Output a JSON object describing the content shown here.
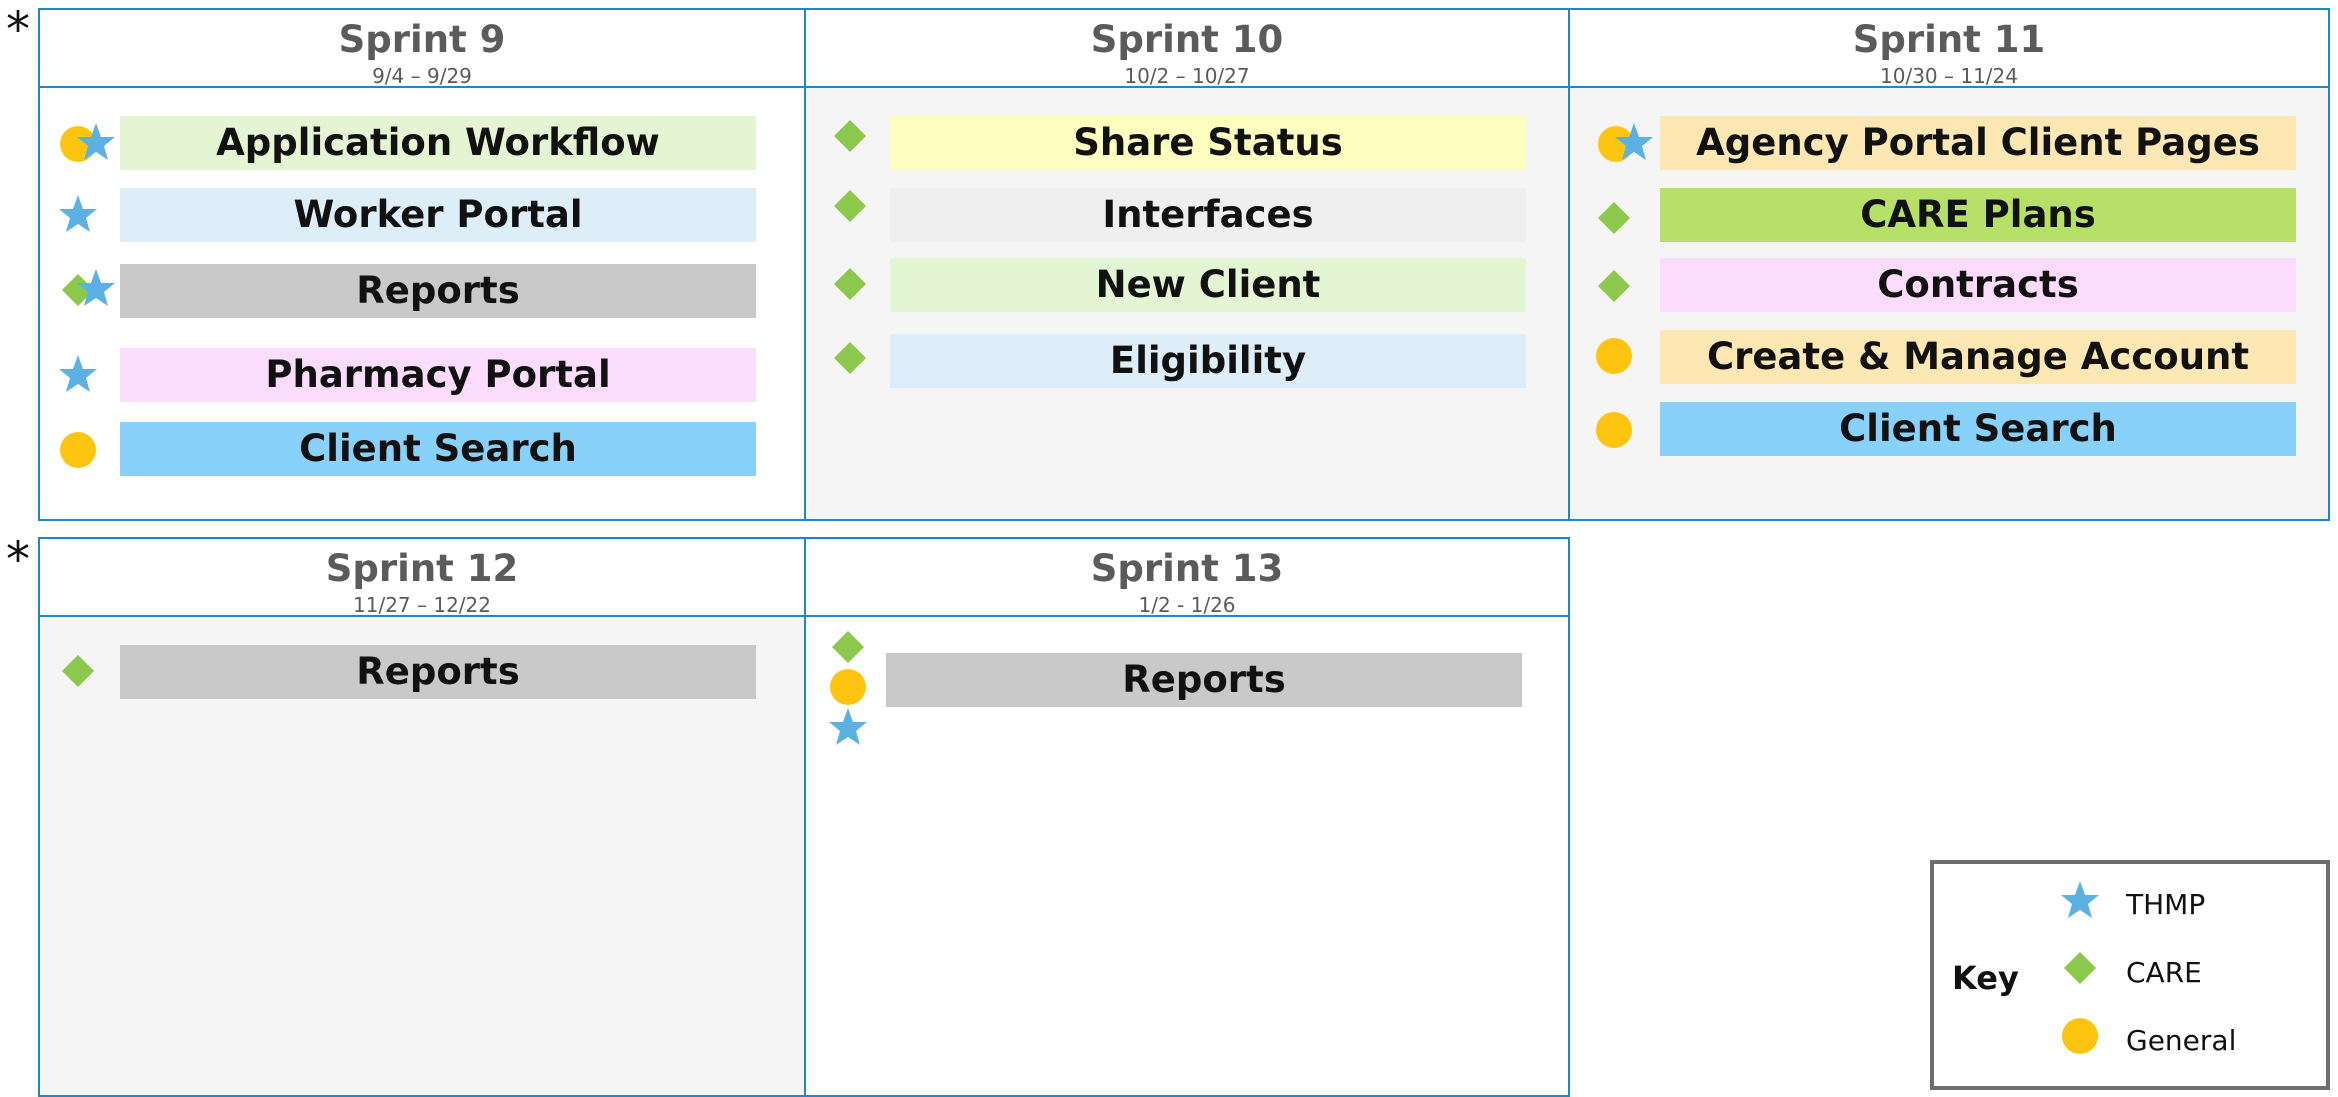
{
  "colors": {
    "border": "#1f86c8",
    "thmp": "#5bb1e4",
    "care": "#8cc84b",
    "general": "#fdc50f"
  },
  "markers": [
    "*",
    "*"
  ],
  "sprints": {
    "s9": {
      "title": "Sprint 9",
      "dates": "9/4 – 9/29",
      "items": [
        {
          "label": "Application Workflow",
          "color": "#e4f5d4",
          "icons": [
            "general",
            "thmp"
          ]
        },
        {
          "label": "Worker Portal",
          "color": "#ddeef8",
          "icons": [
            "thmp"
          ]
        },
        {
          "label": "Reports",
          "color": "#c9c9c9",
          "icons": [
            "care",
            "thmp"
          ]
        },
        {
          "label": "Pharmacy Portal",
          "color": "#fcdcfc",
          "icons": [
            "thmp"
          ]
        },
        {
          "label": "Client Search",
          "color": "#88d1fb",
          "icons": [
            "general"
          ]
        }
      ]
    },
    "s10": {
      "title": "Sprint 10",
      "dates": "10/2 – 10/27",
      "items": [
        {
          "label": "Share Status",
          "color": "#fdfdbd",
          "icons": [
            "care"
          ]
        },
        {
          "label": "Interfaces",
          "color": "#efefef",
          "icons": [
            "care"
          ]
        },
        {
          "label": "New Client",
          "color": "#e4f5d4",
          "icons": [
            "care"
          ]
        },
        {
          "label": "Eligibility",
          "color": "#ddeef8",
          "icons": [
            "care"
          ]
        }
      ]
    },
    "s11": {
      "title": "Sprint 11",
      "dates": "10/30 – 11/24",
      "items": [
        {
          "label": "Agency Portal Client Pages",
          "color": "#fde8b3",
          "icons": [
            "general",
            "thmp"
          ]
        },
        {
          "label": "CARE Plans",
          "color": "#b6e068",
          "icons": [
            "care"
          ]
        },
        {
          "label": "Contracts",
          "color": "#fcdcfc",
          "icons": [
            "care"
          ]
        },
        {
          "label": "Create & Manage Account",
          "color": "#fde8b3",
          "icons": [
            "general"
          ]
        },
        {
          "label": "Client Search",
          "color": "#88d1fb",
          "icons": [
            "general"
          ]
        }
      ]
    },
    "s12": {
      "title": "Sprint 12",
      "dates": "11/27 – 12/22",
      "items": [
        {
          "label": "Reports",
          "color": "#c9c9c9",
          "icons": [
            "care"
          ]
        }
      ]
    },
    "s13": {
      "title": "Sprint 13",
      "dates": "1/2 - 1/26",
      "items": [
        {
          "label": "Reports",
          "color": "#c9c9c9",
          "icons": [
            "care",
            "general",
            "thmp"
          ]
        }
      ]
    }
  },
  "key": {
    "title": "Key",
    "entries": [
      {
        "icon": "thmp",
        "label": "THMP"
      },
      {
        "icon": "care",
        "label": "CARE"
      },
      {
        "icon": "general",
        "label": "General"
      }
    ]
  }
}
